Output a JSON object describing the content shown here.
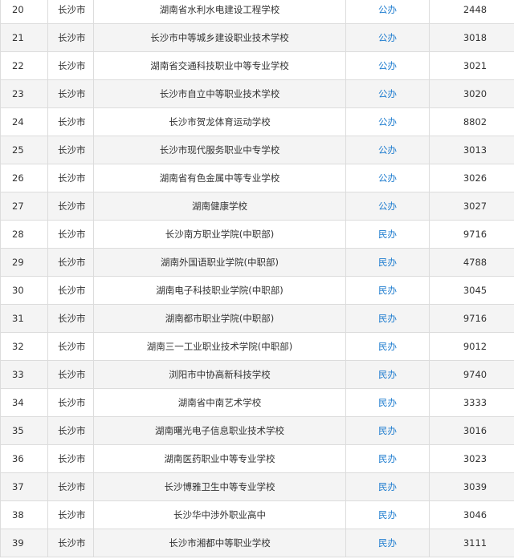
{
  "rows": [
    {
      "num": "20",
      "city": "长沙市",
      "school": "湖南省水利水电建设工程学校",
      "type": "公办",
      "code": "2448"
    },
    {
      "num": "21",
      "city": "长沙市",
      "school": "长沙市中等城乡建设职业技术学校",
      "type": "公办",
      "code": "3018"
    },
    {
      "num": "22",
      "city": "长沙市",
      "school": "湖南省交通科技职业中等专业学校",
      "type": "公办",
      "code": "3021"
    },
    {
      "num": "23",
      "city": "长沙市",
      "school": "长沙市自立中等职业技术学校",
      "type": "公办",
      "code": "3020"
    },
    {
      "num": "24",
      "city": "长沙市",
      "school": "长沙市贺龙体育运动学校",
      "type": "公办",
      "code": "8802"
    },
    {
      "num": "25",
      "city": "长沙市",
      "school": "长沙市现代服务职业中专学校",
      "type": "公办",
      "code": "3013"
    },
    {
      "num": "26",
      "city": "长沙市",
      "school": "湖南省有色金属中等专业学校",
      "type": "公办",
      "code": "3026"
    },
    {
      "num": "27",
      "city": "长沙市",
      "school": "湖南健康学校",
      "type": "公办",
      "code": "3027"
    },
    {
      "num": "28",
      "city": "长沙市",
      "school": "长沙南方职业学院(中职部)",
      "type": "民办",
      "code": "9716"
    },
    {
      "num": "29",
      "city": "长沙市",
      "school": "湖南外国语职业学院(中职部)",
      "type": "民办",
      "code": "4788"
    },
    {
      "num": "30",
      "city": "长沙市",
      "school": "湖南电子科技职业学院(中职部)",
      "type": "民办",
      "code": "3045"
    },
    {
      "num": "31",
      "city": "长沙市",
      "school": "湖南都市职业学院(中职部)",
      "type": "民办",
      "code": "9716"
    },
    {
      "num": "32",
      "city": "长沙市",
      "school": "湖南三一工业职业技术学院(中职部)",
      "type": "民办",
      "code": "9012"
    },
    {
      "num": "33",
      "city": "长沙市",
      "school": "浏阳市中协高新科技学校",
      "type": "民办",
      "code": "9740"
    },
    {
      "num": "34",
      "city": "长沙市",
      "school": "湖南省中南艺术学校",
      "type": "民办",
      "code": "3333"
    },
    {
      "num": "35",
      "city": "长沙市",
      "school": "湖南曙光电子信息职业技术学校",
      "type": "民办",
      "code": "3016"
    },
    {
      "num": "36",
      "city": "长沙市",
      "school": "湖南医药职业中等专业学校",
      "type": "民办",
      "code": "3023"
    },
    {
      "num": "37",
      "city": "长沙市",
      "school": "长沙博雅卫生中等专业学校",
      "type": "民办",
      "code": "3039"
    },
    {
      "num": "38",
      "city": "长沙市",
      "school": "长沙华中涉外职业高中",
      "type": "民办",
      "code": "3046"
    },
    {
      "num": "39",
      "city": "长沙市",
      "school": "长沙市湘都中等职业学校",
      "type": "民办",
      "code": "3111"
    }
  ],
  "colors": {
    "type_link": "#1e7ccf",
    "text": "#333333",
    "border": "#dcdcdc",
    "row_alt": "#f4f4f4"
  }
}
